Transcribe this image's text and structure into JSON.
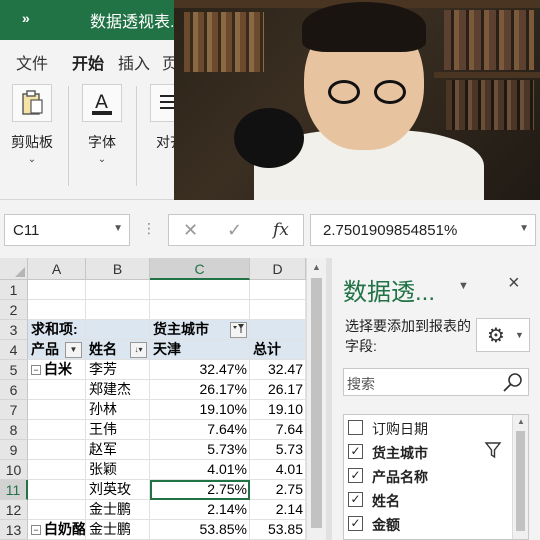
{
  "titlebar": {
    "expand": "»",
    "title": "数据透视表.x"
  },
  "ribbon_tabs": [
    {
      "label": "文件"
    },
    {
      "label": "开始"
    },
    {
      "label": "插入"
    },
    {
      "label": "页"
    }
  ],
  "ribbon_groups": [
    {
      "label": "剪贴板",
      "icon": "clipboard-icon"
    },
    {
      "label": "字体",
      "icon": "font-color-icon"
    },
    {
      "label": "对齐",
      "icon": "align-icon"
    }
  ],
  "formula_bar": {
    "name_box": "C11",
    "value": "2.7501909854851%",
    "fx": "fx"
  },
  "columns": [
    "A",
    "B",
    "C",
    "D"
  ],
  "rows": [
    {
      "num": "1",
      "cells": [
        "",
        "",
        "",
        ""
      ]
    },
    {
      "num": "2",
      "cells": [
        "",
        "",
        "",
        ""
      ]
    },
    {
      "num": "3",
      "cells": [
        "求和项:",
        "",
        "货主城市",
        ""
      ]
    },
    {
      "num": "4",
      "cells": [
        "产品",
        "姓名",
        "天津",
        "总计"
      ]
    },
    {
      "num": "5",
      "cells": [
        "白米",
        "李芳",
        "32.47%",
        "32.47"
      ]
    },
    {
      "num": "6",
      "cells": [
        "",
        "郑建杰",
        "26.17%",
        "26.17"
      ]
    },
    {
      "num": "7",
      "cells": [
        "",
        "孙林",
        "19.10%",
        "19.10"
      ]
    },
    {
      "num": "8",
      "cells": [
        "",
        "王伟",
        "7.64%",
        "7.64"
      ]
    },
    {
      "num": "9",
      "cells": [
        "",
        "赵军",
        "5.73%",
        "5.73"
      ]
    },
    {
      "num": "10",
      "cells": [
        "",
        "张颖",
        "4.01%",
        "4.01"
      ]
    },
    {
      "num": "11",
      "cells": [
        "",
        "刘英玫",
        "2.75%",
        "2.75"
      ]
    },
    {
      "num": "12",
      "cells": [
        "",
        "金士鹏",
        "2.14%",
        "2.14"
      ]
    },
    {
      "num": "13",
      "cells": [
        "白奶酪",
        "金士鹏",
        "53.85%",
        "53.85"
      ]
    }
  ],
  "pivot_pane": {
    "title": "数据透...",
    "close": "×",
    "description": "选择要添加到报表的字段:",
    "search_placeholder": "搜索",
    "fields": [
      {
        "label": "订购日期",
        "checked": false,
        "bold": false
      },
      {
        "label": "货主城市",
        "checked": true,
        "bold": true
      },
      {
        "label": "产品名称",
        "checked": true,
        "bold": true
      },
      {
        "label": "姓名",
        "checked": true,
        "bold": true
      },
      {
        "label": "金额",
        "checked": true,
        "bold": true
      }
    ]
  },
  "colors": {
    "excel_green": "#217346",
    "pivot_header_bg": "#dce6f1"
  }
}
